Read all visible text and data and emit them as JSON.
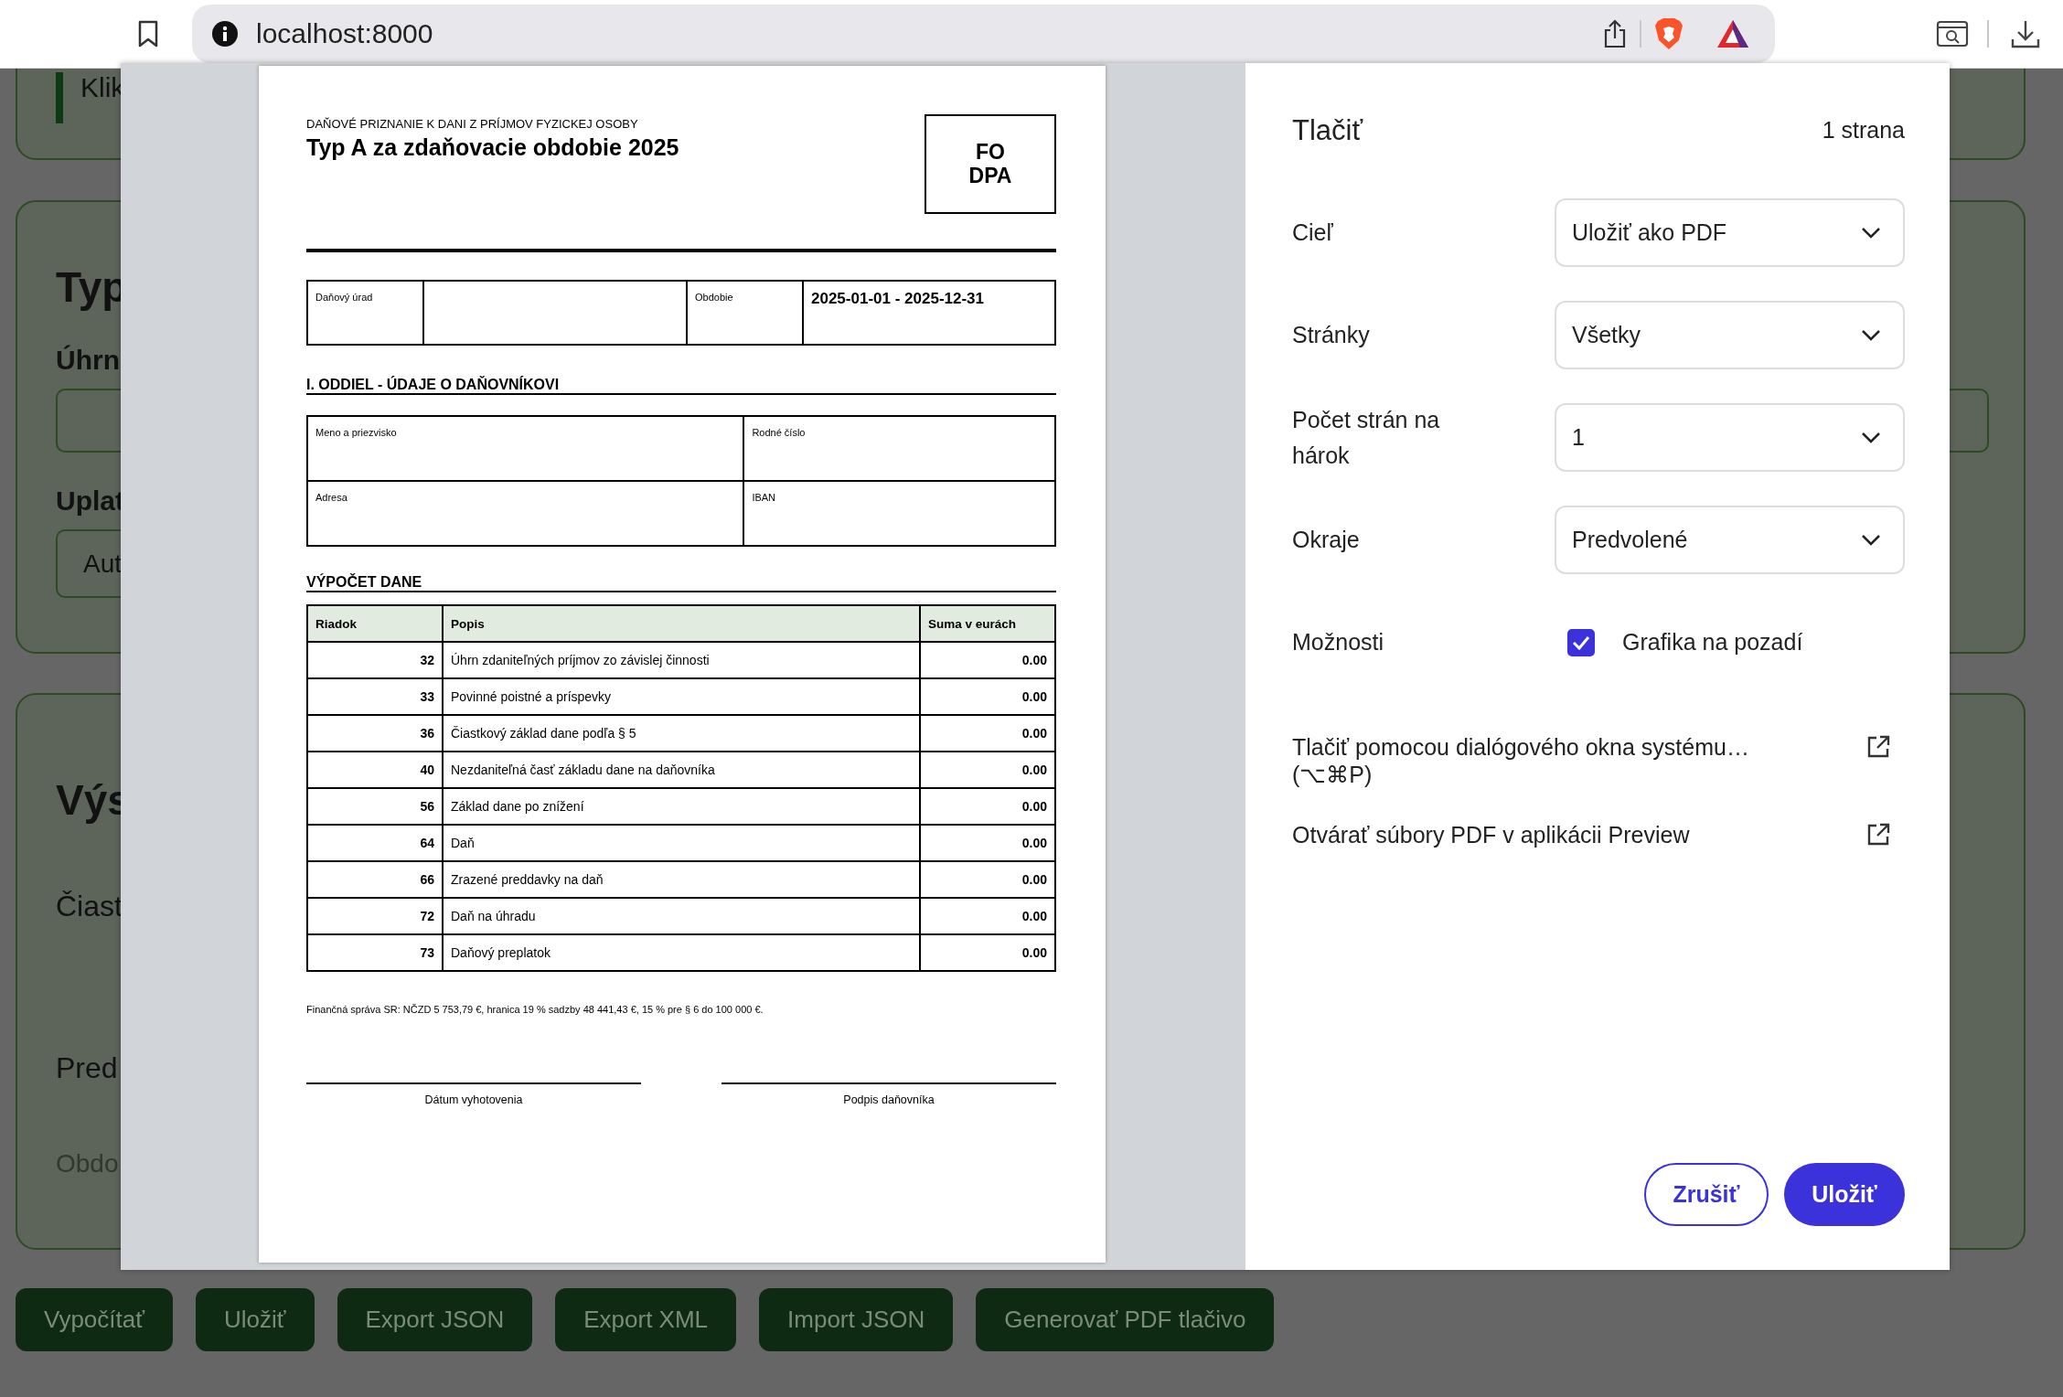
{
  "browser": {
    "url": "localhost:8000"
  },
  "background_page": {
    "notice": "Klik",
    "type_section": {
      "heading": "Typ",
      "income_label": "Úhrn",
      "apply_label": "Uplat",
      "apply_value": "Aut"
    },
    "results_section": {
      "heading": "Výs",
      "lines": [
        {
          "text": "Čiast",
          "muted": false
        },
        {
          "text": "Pred",
          "muted": false
        },
        {
          "text": "Obdo",
          "muted": true
        }
      ]
    },
    "buttons": [
      "Vypočítať",
      "Uložiť",
      "Export JSON",
      "Export XML",
      "Import JSON",
      "Generovať PDF tlačivo"
    ]
  },
  "print_preview": {
    "document": {
      "form_caption": "DAŇOVÉ PRIZNANIE K DANI Z PRÍJMOV FYZICKEJ OSOBY",
      "title": "Typ A za zdaňovacie obdobie 2025",
      "form_code": [
        "FO",
        "DPA"
      ],
      "tax_office_label": "Daňový úrad",
      "period_label": "Obdobie",
      "period_value": "2025-01-01 - 2025-12-31",
      "taxpayer_section": {
        "heading": "I. ODDIEL - ÚDAJE O DAŇOVNÍKOVI",
        "fields": [
          "Meno a priezvisko",
          "Rodné číslo",
          "Adresa",
          "IBAN"
        ]
      },
      "tax_section": {
        "heading": "VÝPOČET DANE",
        "columns": [
          "Riadok",
          "Popis",
          "Suma v eurách"
        ],
        "rows": [
          {
            "line": "32",
            "description": "Úhrn zdaniteľných príjmov zo závislej činnosti",
            "amount": "0.00"
          },
          {
            "line": "33",
            "description": "Povinné poistné a príspevky",
            "amount": "0.00"
          },
          {
            "line": "36",
            "description": "Čiastkový základ dane podľa § 5",
            "amount": "0.00"
          },
          {
            "line": "40",
            "description": "Nezdaniteľná časť základu dane na daňovníka",
            "amount": "0.00"
          },
          {
            "line": "56",
            "description": "Základ dane po znížení",
            "amount": "0.00"
          },
          {
            "line": "64",
            "description": "Daň",
            "amount": "0.00"
          },
          {
            "line": "66",
            "description": "Zrazené preddavky na daň",
            "amount": "0.00"
          },
          {
            "line": "72",
            "description": "Daň na úhradu",
            "amount": "0.00"
          },
          {
            "line": "73",
            "description": "Daňový preplatok",
            "amount": "0.00"
          }
        ]
      },
      "footnote": "Finančná správa SR: NČZD 5 753,79 €, hranica 19 % sadzby 48 441,43 €, 15 % pre § 6 do 100 000 €.",
      "signatures": [
        "Dátum vyhotovenia",
        "Podpis daňovníka"
      ]
    }
  },
  "print_dialog": {
    "title": "Tlačiť",
    "page_count": "1 strana",
    "settings": [
      {
        "kind": "select",
        "label": "Cieľ",
        "value": "Uložiť ako PDF"
      },
      {
        "kind": "select",
        "label": "Stránky",
        "value": "Všetky"
      },
      {
        "kind": "select",
        "label": "Počet strán na hárok",
        "value": "1"
      },
      {
        "kind": "select",
        "label": "Okraje",
        "value": "Predvolené"
      },
      {
        "kind": "checkbox",
        "label": "Možnosti",
        "option": "Grafika na pozadí",
        "checked": true
      }
    ],
    "links": [
      "Tlačiť pomocou dialógového okna systému… (⌥⌘P)",
      "Otvárať súbory PDF v aplikácii Preview"
    ],
    "buttons": [
      {
        "label": "Zrušiť",
        "kind": "secondary"
      },
      {
        "label": "Uložiť",
        "kind": "primary"
      }
    ]
  }
}
